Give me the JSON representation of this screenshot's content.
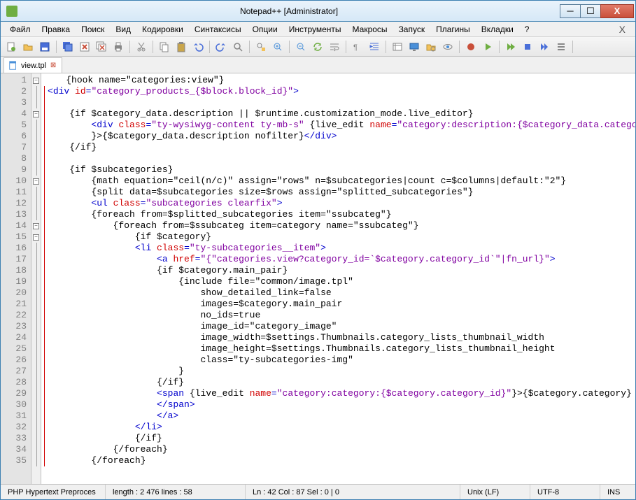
{
  "window": {
    "title": "Notepad++  [Administrator]"
  },
  "menu": [
    "Файл",
    "Правка",
    "Поиск",
    "Вид",
    "Кодировки",
    "Синтаксисы",
    "Опции",
    "Инструменты",
    "Макросы",
    "Запуск",
    "Плагины",
    "Вкладки",
    "?"
  ],
  "tab": {
    "name": "view.tpl"
  },
  "code_lines": [
    [
      {
        "t": "{hook name=\"categories:view\"}",
        "c": "txt",
        "i": 4
      }
    ],
    [
      {
        "t": "<",
        "c": "kw",
        "i": 0
      },
      {
        "t": "div ",
        "c": "kw"
      },
      {
        "t": "id",
        "c": "attr"
      },
      {
        "t": "=",
        "c": "kw"
      },
      {
        "t": "\"category_products_{$block.block_id}\"",
        "c": "str"
      },
      {
        "t": ">",
        "c": "kw"
      }
    ],
    [
      {
        "t": "",
        "i": 0
      }
    ],
    [
      {
        "t": "{if $category_data.description || $runtime.customization_mode.live_editor}",
        "c": "txt",
        "i": 4
      }
    ],
    [
      {
        "t": "<",
        "c": "kw",
        "i": 8
      },
      {
        "t": "div ",
        "c": "kw"
      },
      {
        "t": "class",
        "c": "attr"
      },
      {
        "t": "=",
        "c": "kw"
      },
      {
        "t": "\"ty-wysiwyg-content ty-mb-s\"",
        "c": "str"
      },
      {
        "t": " {live_edit ",
        "c": "txt"
      },
      {
        "t": "name",
        "c": "attr"
      },
      {
        "t": "=",
        "c": "kw"
      },
      {
        "t": "\"category:description:{$category_data.category_id}\"",
        "c": "str"
      }
    ],
    [
      {
        "t": "}>{$category_data.description nofilter}",
        "c": "txt",
        "i": 8
      },
      {
        "t": "</div>",
        "c": "kw"
      }
    ],
    [
      {
        "t": "{/if}",
        "c": "txt",
        "i": 4
      }
    ],
    [
      {
        "t": "",
        "i": 0
      }
    ],
    [
      {
        "t": "{if $subcategories}",
        "c": "txt",
        "i": 4
      }
    ],
    [
      {
        "t": "{math equation=\"ceil(n/c)\" assign=\"rows\" n=$subcategories|count c=$columns|default:\"2\"}",
        "c": "txt",
        "i": 8
      }
    ],
    [
      {
        "t": "{split data=$subcategories size=$rows assign=\"splitted_subcategories\"}",
        "c": "txt",
        "i": 8
      }
    ],
    [
      {
        "t": "<",
        "c": "kw",
        "i": 8
      },
      {
        "t": "ul ",
        "c": "kw"
      },
      {
        "t": "class",
        "c": "attr"
      },
      {
        "t": "=",
        "c": "kw"
      },
      {
        "t": "\"subcategories clearfix\"",
        "c": "str"
      },
      {
        "t": ">",
        "c": "kw"
      }
    ],
    [
      {
        "t": "{foreach from=$splitted_subcategories item=\"ssubcateg\"}",
        "c": "txt",
        "i": 8
      }
    ],
    [
      {
        "t": "{foreach from=$ssubcateg item=category name=\"ssubcateg\"}",
        "c": "txt",
        "i": 12
      }
    ],
    [
      {
        "t": "{if $category}",
        "c": "txt",
        "i": 16
      }
    ],
    [
      {
        "t": "<",
        "c": "kw",
        "i": 16
      },
      {
        "t": "li ",
        "c": "kw"
      },
      {
        "t": "class",
        "c": "attr"
      },
      {
        "t": "=",
        "c": "kw"
      },
      {
        "t": "\"ty-subcategories__item\"",
        "c": "str"
      },
      {
        "t": ">",
        "c": "kw"
      }
    ],
    [
      {
        "t": "<",
        "c": "kw",
        "i": 20
      },
      {
        "t": "a ",
        "c": "kw"
      },
      {
        "t": "href",
        "c": "attr"
      },
      {
        "t": "=",
        "c": "kw"
      },
      {
        "t": "\"{\"categories.view?category_id=`$category.category_id`\"|fn_url}\"",
        "c": "str"
      },
      {
        "t": ">",
        "c": "kw"
      }
    ],
    [
      {
        "t": "{if $category.main_pair}",
        "c": "txt",
        "i": 20
      }
    ],
    [
      {
        "t": "{include file=\"common/image.tpl\"",
        "c": "txt",
        "i": 24
      }
    ],
    [
      {
        "t": "show_detailed_link=false",
        "c": "txt",
        "i": 28
      }
    ],
    [
      {
        "t": "images=$category.main_pair",
        "c": "txt",
        "i": 28
      }
    ],
    [
      {
        "t": "no_ids=true",
        "c": "txt",
        "i": 28
      }
    ],
    [
      {
        "t": "image_id=\"category_image\"",
        "c": "txt",
        "i": 28
      }
    ],
    [
      {
        "t": "image_width=$settings.Thumbnails.category_lists_thumbnail_width",
        "c": "txt",
        "i": 28
      }
    ],
    [
      {
        "t": "image_height=$settings.Thumbnails.category_lists_thumbnail_height",
        "c": "txt",
        "i": 28
      }
    ],
    [
      {
        "t": "class=\"ty-subcategories-img\"",
        "c": "txt",
        "i": 28
      }
    ],
    [
      {
        "t": "}",
        "c": "txt",
        "i": 24
      }
    ],
    [
      {
        "t": "{/if}",
        "c": "txt",
        "i": 20
      }
    ],
    [
      {
        "t": "<",
        "c": "kw",
        "i": 20
      },
      {
        "t": "span ",
        "c": "kw"
      },
      {
        "t": "{live_edit ",
        "c": "txt"
      },
      {
        "t": "name",
        "c": "attr"
      },
      {
        "t": "=",
        "c": "kw"
      },
      {
        "t": "\"category:category:{$category.category_id}\"",
        "c": "str"
      },
      {
        "t": "}>{$category.category}",
        "c": "txt"
      }
    ],
    [
      {
        "t": "</span>",
        "c": "kw",
        "i": 20
      }
    ],
    [
      {
        "t": "</a>",
        "c": "kw",
        "i": 20
      }
    ],
    [
      {
        "t": "</li>",
        "c": "kw",
        "i": 16
      }
    ],
    [
      {
        "t": "{/if}",
        "c": "txt",
        "i": 16
      }
    ],
    [
      {
        "t": "{/foreach}",
        "c": "txt",
        "i": 12
      }
    ],
    [
      {
        "t": "{/foreach}",
        "c": "txt",
        "i": 8
      }
    ]
  ],
  "fold_markers": {
    "1": "minus",
    "4": "minus",
    "10": "minus",
    "14": "minus",
    "15": "minus"
  },
  "status": {
    "lang": "PHP Hypertext Preproces",
    "length": "length : 2 476    lines : 58",
    "pos": "Ln : 42    Col : 87    Sel : 0 | 0",
    "eol": "Unix (LF)",
    "enc": "UTF-8",
    "ins": "INS"
  },
  "toolbar_icons": [
    "new",
    "open",
    "save",
    "save-all",
    "close",
    "close-all",
    "print",
    "cut",
    "copy",
    "paste",
    "undo",
    "redo",
    "find",
    "replace",
    "zoom-in",
    "zoom-out",
    "sync",
    "wrap",
    "all-chars",
    "indent",
    "lang",
    "monitor",
    "folder",
    "eye",
    "record",
    "play",
    "play-mult",
    "stop",
    "fwd",
    "list"
  ]
}
